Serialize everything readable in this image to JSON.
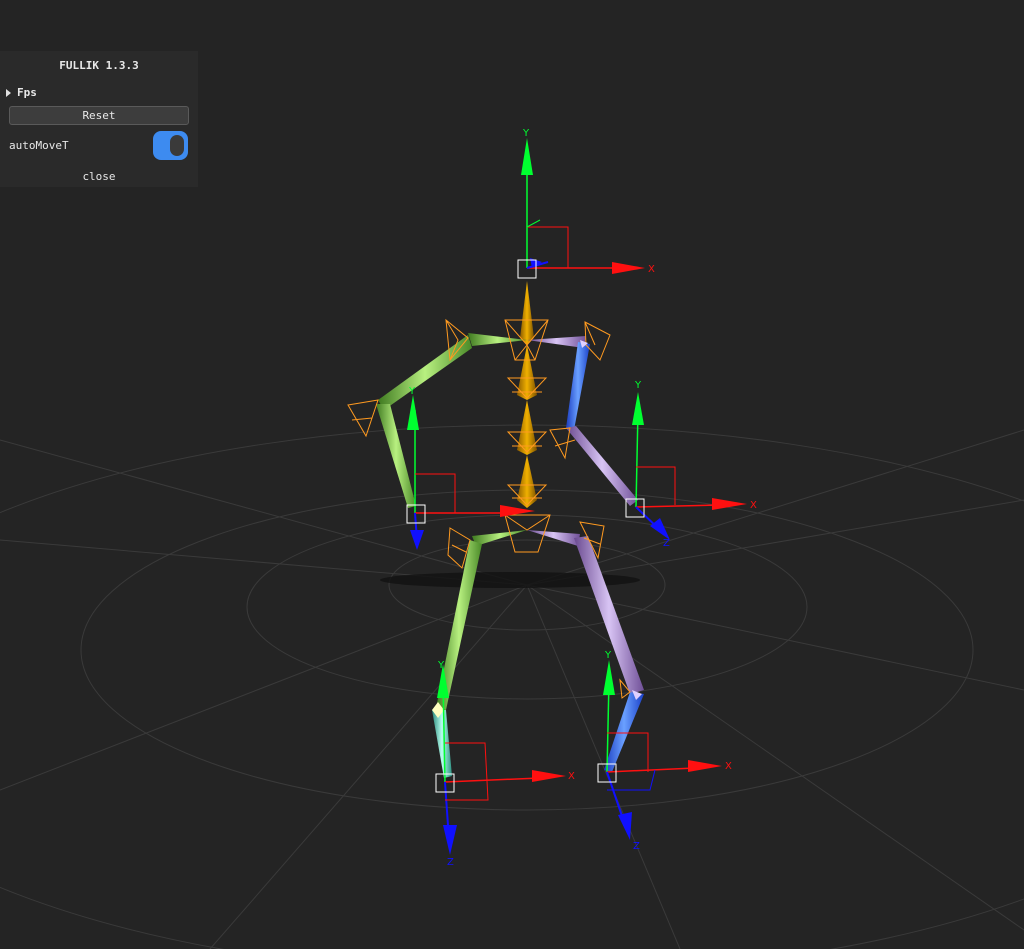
{
  "panel": {
    "title": "FULLIK 1.3.3",
    "fps_label": "Fps",
    "reset_label": "Reset",
    "auto_move_label": "autoMoveT",
    "auto_move_on": true,
    "close_label": "close"
  },
  "axis_labels": {
    "x": "X",
    "y": "Y",
    "z": "Z"
  },
  "colors": {
    "background": "#242424",
    "toggle_on": "#3d8bf0",
    "spine": "#d99a10",
    "left_limb": "#8cd650",
    "right_limb": "#b49be0",
    "foot_blue": "#3a74ff",
    "wire": "#ff9a20"
  }
}
